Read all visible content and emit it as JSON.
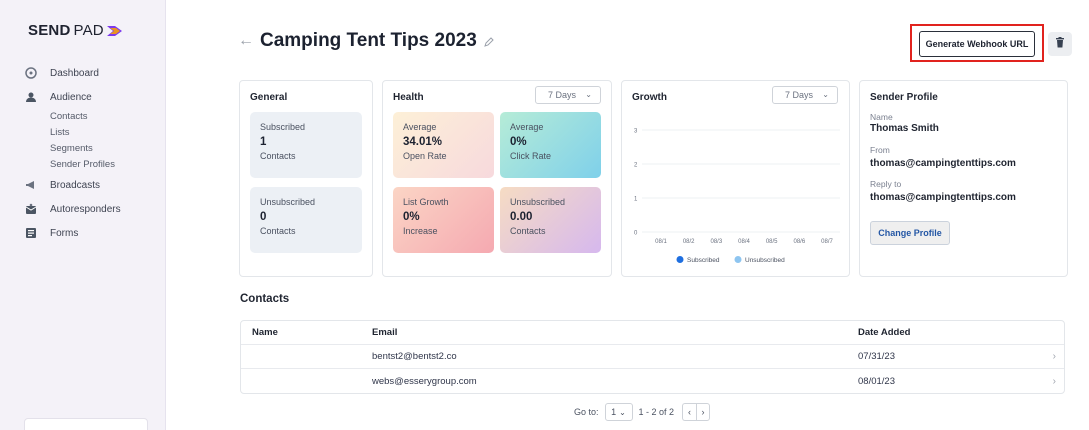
{
  "brand": {
    "name_bold": "SEND",
    "name_light": "PAD"
  },
  "sidebar": {
    "items": [
      {
        "label": "Dashboard",
        "icon": "dashboard-icon"
      },
      {
        "label": "Audience",
        "icon": "audience-icon"
      },
      {
        "label": "Broadcasts",
        "icon": "megaphone-icon"
      },
      {
        "label": "Autoresponders",
        "icon": "envelope-icon"
      },
      {
        "label": "Forms",
        "icon": "form-icon"
      }
    ],
    "audience_sub": [
      "Contacts",
      "Lists",
      "Segments",
      "Sender Profiles"
    ]
  },
  "header": {
    "back": "←",
    "title": "Camping Tent Tips 2023",
    "webhook_button": "Generate Webhook URL"
  },
  "general": {
    "title": "General",
    "subscribed": {
      "label": "Subscribed",
      "value": "1",
      "unit": "Contacts"
    },
    "unsubscribed": {
      "label": "Unsubscribed",
      "value": "0",
      "unit": "Contacts"
    }
  },
  "health": {
    "title": "Health",
    "range": "7 Days",
    "open": {
      "label": "Average",
      "value": "34.01%",
      "unit": "Open Rate"
    },
    "click": {
      "label": "Average",
      "value": "0%",
      "unit": "Click Rate"
    },
    "growth": {
      "label": "List Growth",
      "value": "0%",
      "unit": "Increase"
    },
    "unsub": {
      "label": "Unsubscribed",
      "value": "0.00",
      "unit": "Contacts"
    }
  },
  "growth": {
    "title": "Growth",
    "range": "7 Days"
  },
  "chart_data": {
    "type": "line",
    "title": "Growth",
    "categories": [
      "08/1",
      "08/2",
      "08/3",
      "08/4",
      "08/5",
      "08/6",
      "08/7"
    ],
    "y_ticks": [
      "0",
      "1",
      "2",
      "3"
    ],
    "ylim": [
      0,
      3
    ],
    "grid": true,
    "legend_position": "bottom",
    "series": [
      {
        "name": "Subscribed",
        "color": "#1f6fe0",
        "values": [
          0,
          0,
          0,
          0,
          0,
          0,
          0
        ]
      },
      {
        "name": "Unsubscribed",
        "color": "#8ec5f0",
        "values": [
          0,
          0,
          0,
          0,
          0,
          0,
          0
        ]
      }
    ]
  },
  "sender_profile": {
    "title": "Sender Profile",
    "name_label": "Name",
    "name": "Thomas Smith",
    "from_label": "From",
    "from": "thomas@campingtenttips.com",
    "reply_label": "Reply to",
    "reply": "thomas@campingtenttips.com",
    "change_button": "Change Profile"
  },
  "contacts": {
    "title": "Contacts",
    "columns": [
      "Name",
      "Email",
      "Date Added"
    ],
    "rows": [
      {
        "name": "",
        "email": "bentst2@bentst2.co",
        "date": "07/31/23"
      },
      {
        "name": "",
        "email": "webs@esserygroup.com",
        "date": "08/01/23"
      }
    ]
  },
  "pagination": {
    "goto_label": "Go to:",
    "page": "1",
    "range": "1 - 2 of 2"
  }
}
